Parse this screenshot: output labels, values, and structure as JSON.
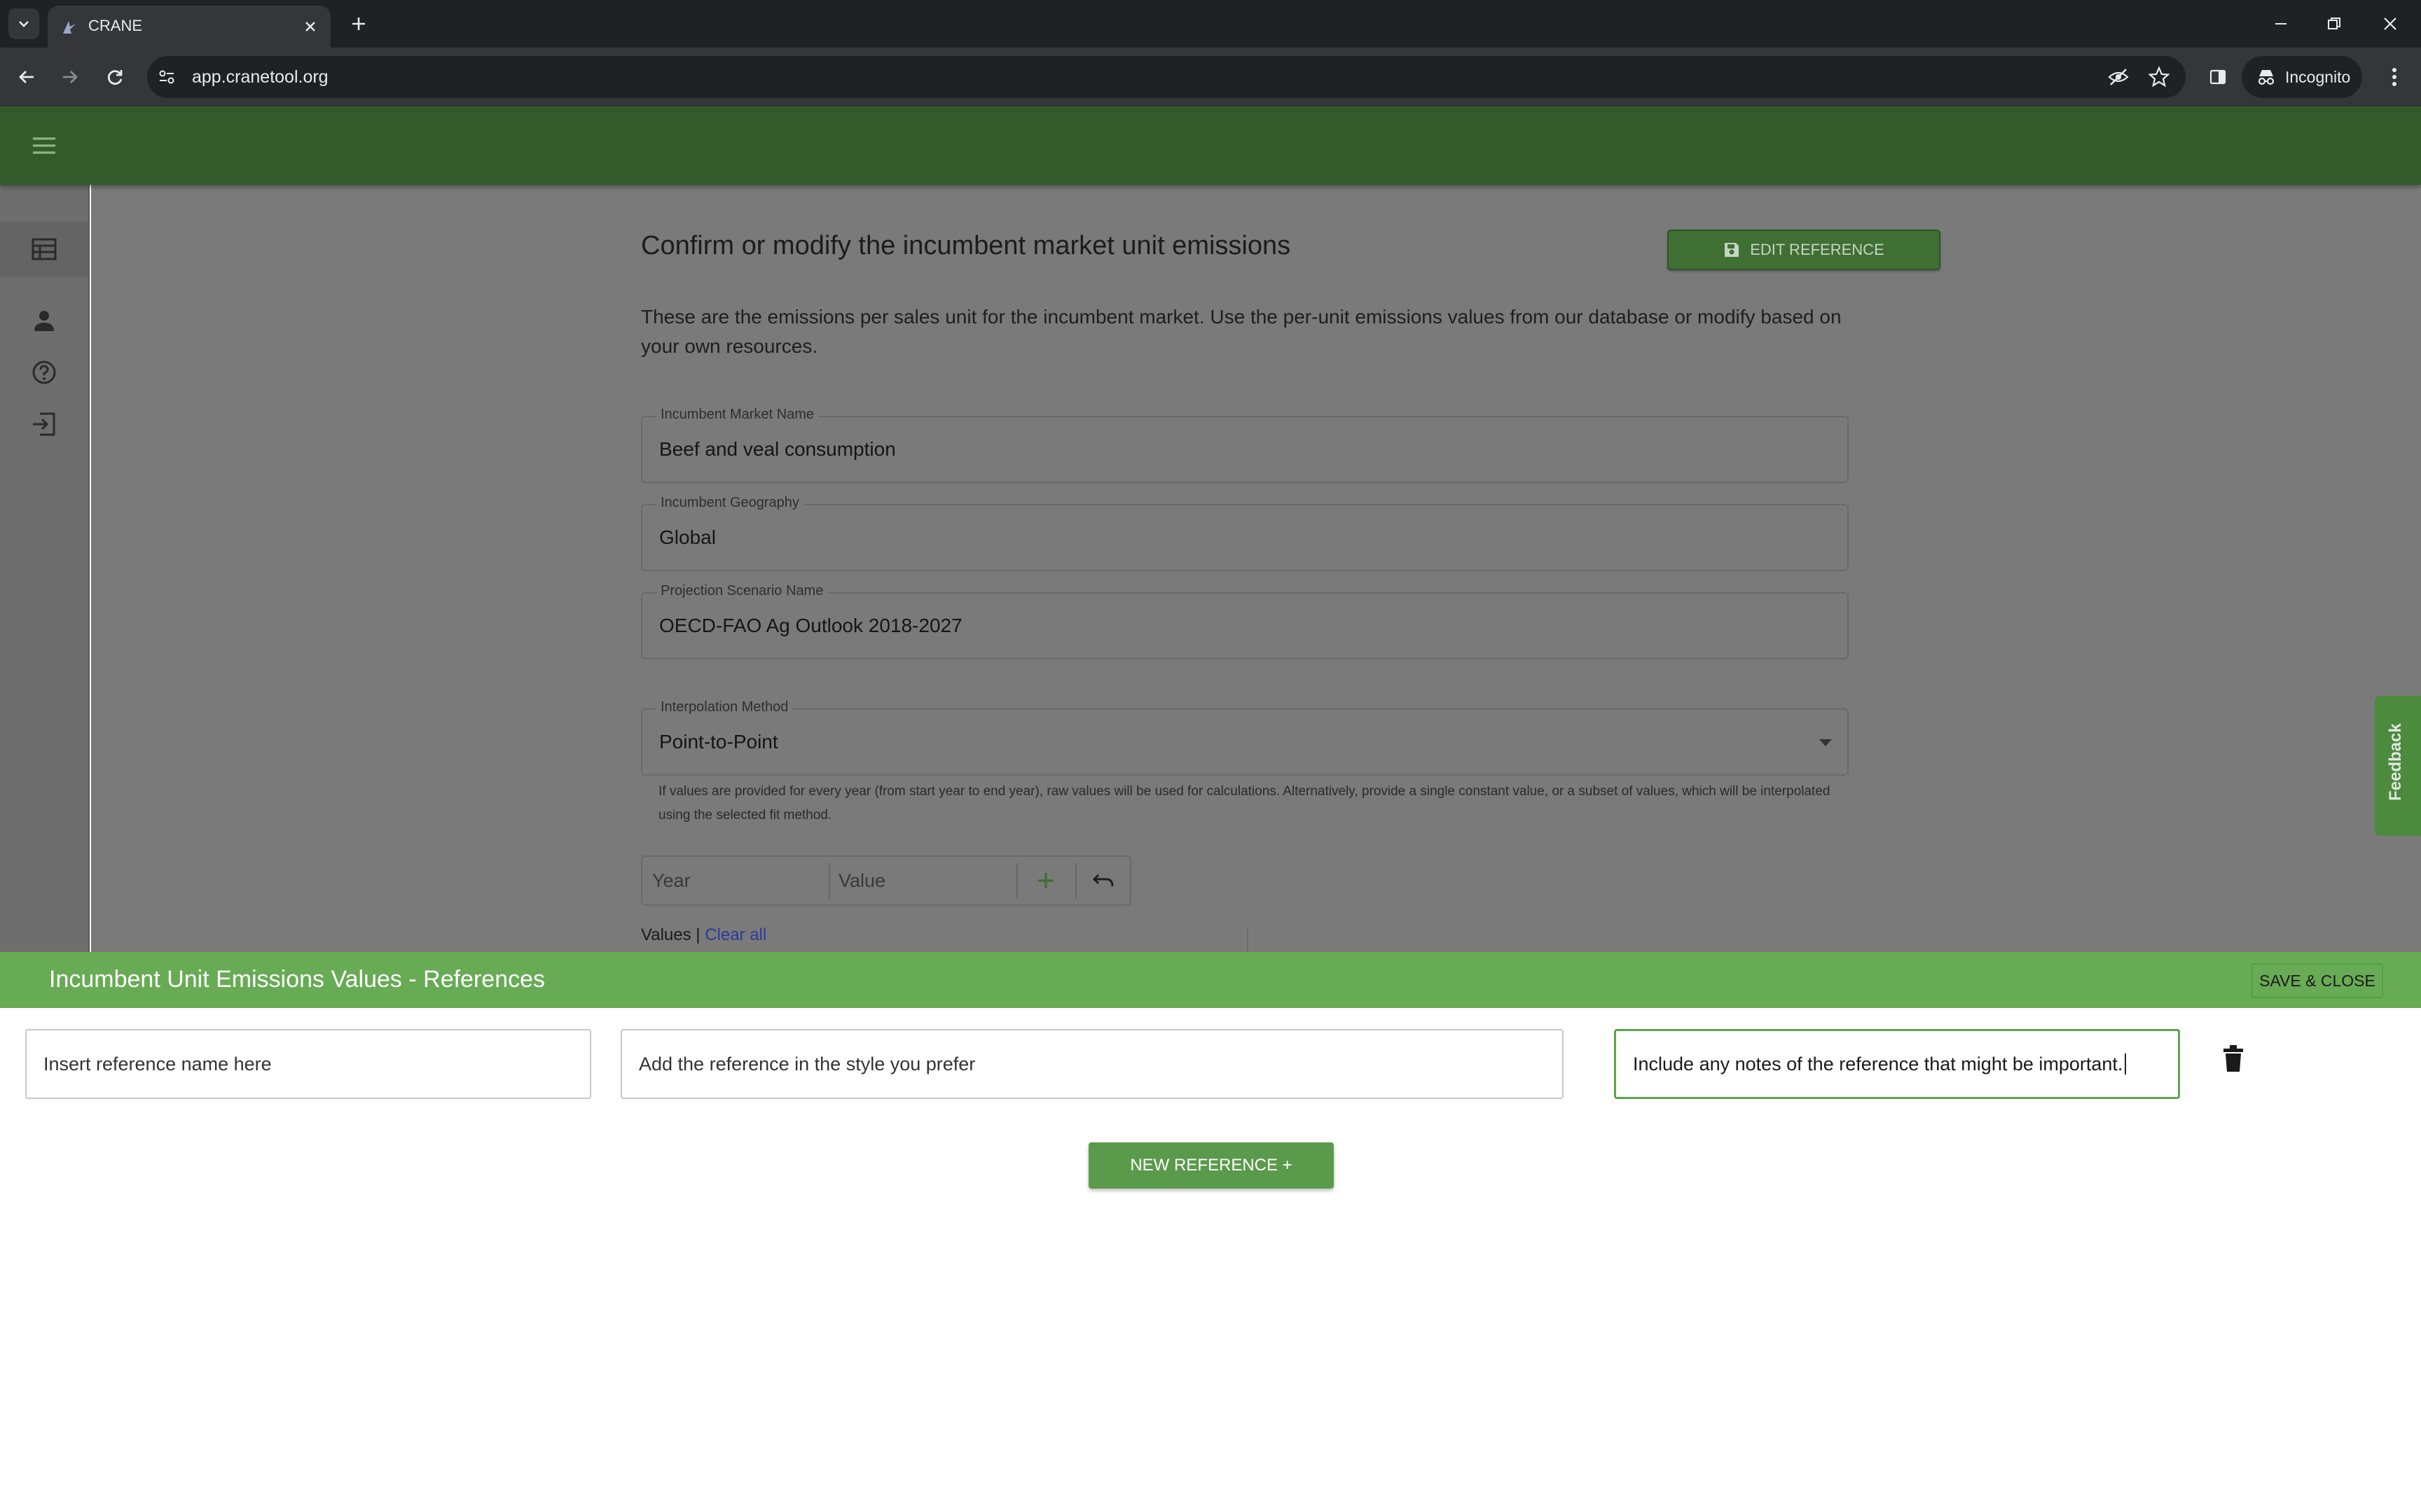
{
  "browser": {
    "tab_title": "CRANE",
    "url": "app.cranetool.org",
    "incognito_label": "Incognito"
  },
  "page": {
    "title": "Confirm or modify the incumbent market unit emissions",
    "edit_reference_label": "EDIT REFERENCE",
    "description": "These are the emissions per sales unit for the incumbent market. Use the per-unit emissions values from our database or modify based on your own resources.",
    "fields": {
      "market": {
        "label": "Incumbent Market Name",
        "value": "Beef and veal consumption"
      },
      "geography": {
        "label": "Incumbent Geography",
        "value": "Global"
      },
      "scenario": {
        "label": "Projection Scenario Name",
        "value": "OECD-FAO Ag Outlook 2018-2027"
      },
      "interpolation": {
        "label": "Interpolation Method",
        "value": "Point-to-Point"
      }
    },
    "helper_text": "If values are provided for every year (from start year to end year), raw values will be used for calculations. Alternatively, provide a single constant value, or a subset of values, which will be interpolated using the selected fit method.",
    "year_placeholder": "Year",
    "value_placeholder": "Value",
    "values_label": "Values",
    "separator": "|",
    "clear_all": "Clear all",
    "feedback": "Feedback"
  },
  "references": {
    "title": "Incumbent Unit Emissions Values - References",
    "save_close": "SAVE & CLOSE",
    "name_placeholder": "Insert reference name here",
    "citation_placeholder": "Add the reference in the style you prefer",
    "notes_value": "Include any notes of the reference that might be important.",
    "new_reference": "NEW REFERENCE +"
  },
  "colors": {
    "app_bar": "#325a2b",
    "accent_green": "#68ab55",
    "button_green": "#5a9a4b",
    "overlay_gray": "#7a7a7a"
  }
}
